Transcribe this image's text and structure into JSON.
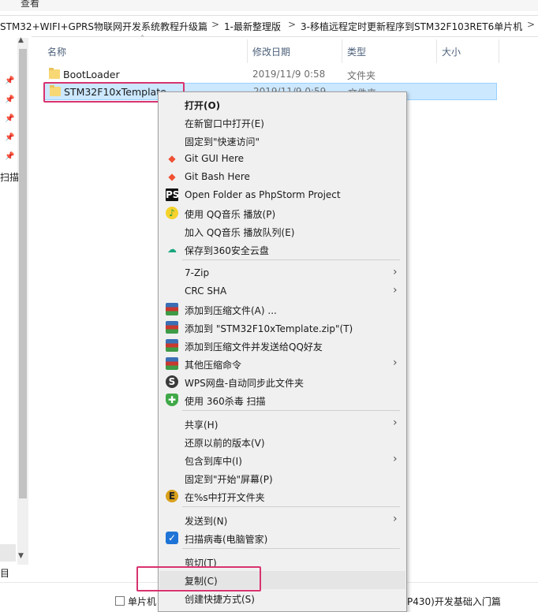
{
  "ribbon": {
    "view_label": "查看"
  },
  "address": {
    "crumbs": [
      "STM32+WIFI+GPRS物联网开发系统教程升级篇",
      "1-最新整理版",
      "3-移植远程定时更新程序到STM32F103RET6单片机"
    ],
    "separator": ">"
  },
  "columns": {
    "name": "名称",
    "date": "修改日期",
    "type": "类型",
    "size": "大小"
  },
  "files": [
    {
      "name": "BootLoader",
      "date": "2019/11/9 0:58",
      "type": "文件夹",
      "selected": false
    },
    {
      "name": "STM32F10xTemplate",
      "date": "2019/11/9 0:59",
      "type": "文件夹",
      "selected": true
    }
  ],
  "nav": {
    "scan_label": "扫描",
    "bottom_label": "目"
  },
  "status": {
    "left_text": "单片机",
    "right_text": "P430)开发基础入门篇"
  },
  "menu": {
    "items": [
      {
        "label": "打开(O)",
        "bold": true,
        "icon": ""
      },
      {
        "label": "在新窗口中打开(E)",
        "icon": ""
      },
      {
        "label": "固定到\"快速访问\"",
        "icon": ""
      },
      {
        "label": "Git GUI Here",
        "icon": "git-icon"
      },
      {
        "label": "Git Bash Here",
        "icon": "git-icon"
      },
      {
        "label": "Open Folder as PhpStorm Project",
        "icon": "phpstorm-icon"
      },
      {
        "label": "使用 QQ音乐 播放(P)",
        "icon": "qqmusic-icon"
      },
      {
        "label": "加入 QQ音乐 播放队列(E)",
        "icon": ""
      },
      {
        "label": "保存到360安全云盘",
        "icon": "cloud-360-icon"
      },
      {
        "label": "7-Zip",
        "icon": "",
        "submenu": true
      },
      {
        "label": "CRC SHA",
        "icon": "",
        "submenu": true
      },
      {
        "label": "添加到压缩文件(A) ...",
        "icon": "winrar-icon"
      },
      {
        "label": "添加到 \"STM32F10xTemplate.zip\"(T)",
        "icon": "winrar-icon"
      },
      {
        "label": "添加到压缩文件并发送给QQ好友",
        "icon": "winrar-icon"
      },
      {
        "label": "其他压缩命令",
        "icon": "winrar-icon",
        "submenu": true
      },
      {
        "label": "WPS网盘-自动同步此文件夹",
        "icon": "wps-icon"
      },
      {
        "label": "使用 360杀毒 扫描",
        "icon": "antivirus-360-icon"
      },
      {
        "label": "共享(H)",
        "icon": "",
        "submenu": true
      },
      {
        "label": "还原以前的版本(V)",
        "icon": ""
      },
      {
        "label": "包含到库中(I)",
        "icon": "",
        "submenu": true
      },
      {
        "label": "固定到\"开始\"屏幕(P)",
        "icon": ""
      },
      {
        "label": "在%s中打开文件夹",
        "icon": "everything-icon"
      },
      {
        "label": "发送到(N)",
        "icon": "",
        "submenu": true
      },
      {
        "label": "扫描病毒(电脑管家)",
        "icon": "tencent-guard-icon"
      },
      {
        "label": "剪切(T)",
        "icon": ""
      },
      {
        "label": "复制(C)",
        "icon": "",
        "highlighted": true
      },
      {
        "label": "创建快捷方式(S)",
        "icon": ""
      }
    ]
  }
}
